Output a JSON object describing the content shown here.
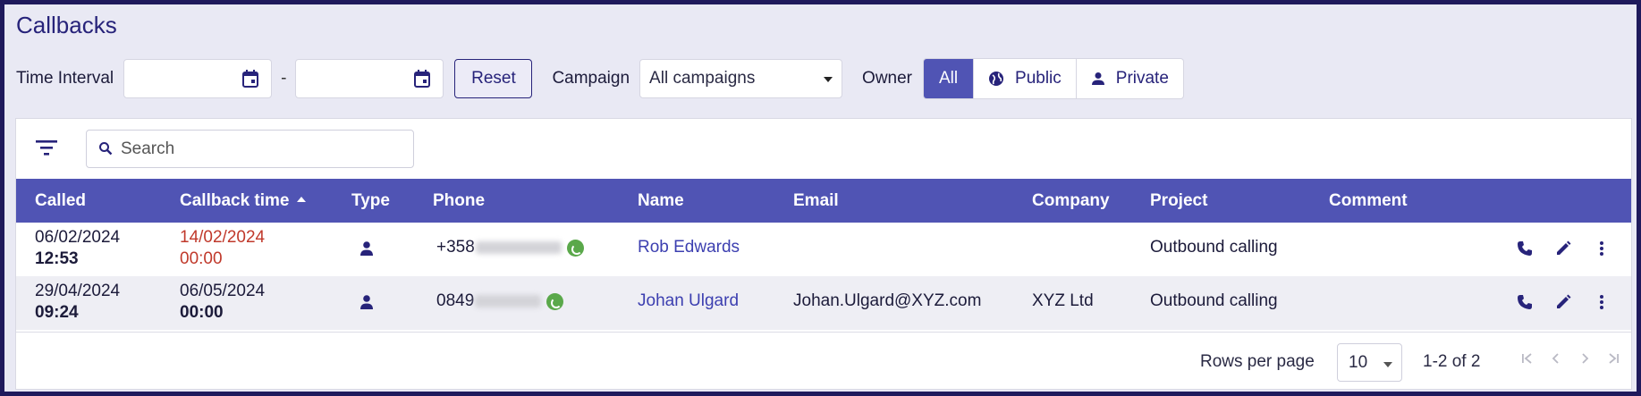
{
  "page": {
    "title": "Callbacks"
  },
  "filters": {
    "time_interval_label": "Time Interval",
    "from_value": "",
    "to_value": "",
    "dash": "-",
    "reset_label": "Reset",
    "campaign_label": "Campaign",
    "campaign_selected": "All campaigns",
    "owner_label": "Owner",
    "owner_options": [
      "All",
      "Public",
      "Private"
    ],
    "owner_active": "All"
  },
  "toolbar": {
    "search_placeholder": "Search"
  },
  "table": {
    "columns": [
      "Called",
      "Callback time",
      "Type",
      "Phone",
      "Name",
      "Email",
      "Company",
      "Project",
      "Comment"
    ],
    "sorted_column": "Callback time",
    "sort_direction": "ascending",
    "rows": [
      {
        "called_date": "06/02/2024",
        "called_time": "12:53",
        "callback_date": "14/02/2024",
        "callback_time": "00:00",
        "callback_overdue": true,
        "type_icon": "person-icon",
        "phone_prefix": "+358",
        "name": "Rob Edwards",
        "email": "",
        "company": "",
        "project": "Outbound calling",
        "comment": ""
      },
      {
        "called_date": "29/04/2024",
        "called_time": "09:24",
        "callback_date": "06/05/2024",
        "callback_time": "00:00",
        "callback_overdue": false,
        "type_icon": "person-icon",
        "phone_prefix": "0849",
        "name": "Johan Ulgard",
        "email": "Johan.Ulgard@XYZ.com",
        "company": "XYZ Ltd",
        "project": "Outbound calling",
        "comment": ""
      }
    ],
    "row_actions": [
      "phone-icon",
      "edit-icon",
      "more-vert-icon"
    ]
  },
  "pagination": {
    "rows_per_page_label": "Rows per page",
    "rows_per_page": "10",
    "range": "1-2 of 2"
  },
  "colors": {
    "accent": "#5054b4",
    "title": "#27237a",
    "link": "#3c3fb0",
    "overdue": "#c0392b",
    "background": "#e9e9f4"
  }
}
